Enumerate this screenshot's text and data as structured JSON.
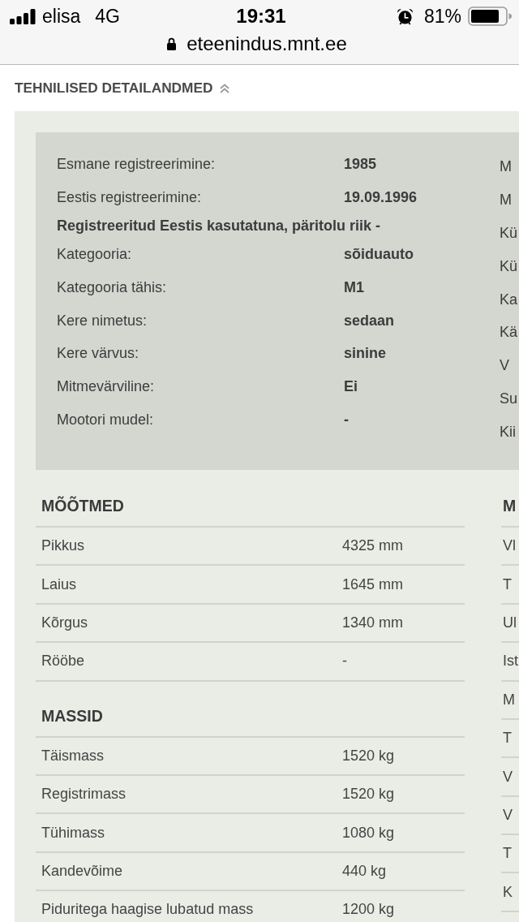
{
  "status_bar": {
    "carrier": "elisa",
    "network": "4G",
    "time": "19:31",
    "battery_percent": "81%"
  },
  "address_bar": {
    "url": "eteenindus.mnt.ee"
  },
  "section": {
    "title": "TEHNILISED DETAILANDMED",
    "expanded": true
  },
  "summary": {
    "left": [
      {
        "kind": "pair",
        "label": "Esmane registreerimine:",
        "value": "1985"
      },
      {
        "kind": "pair",
        "label": "Eestis registreerimine:",
        "value": "19.09.1996"
      },
      {
        "kind": "note",
        "text": "Registreeritud Eestis kasutatuna, päritolu riik -"
      },
      {
        "kind": "pair",
        "label": "Kategooria:",
        "value": "sõiduauto"
      },
      {
        "kind": "pair",
        "label": "Kategooria tähis:",
        "value": "M1"
      },
      {
        "kind": "pair",
        "label": "Kere nimetus:",
        "value": "sedaan"
      },
      {
        "kind": "pair",
        "label": "Kere värvus:",
        "value": "sinine"
      },
      {
        "kind": "pair",
        "label": "Mitmevärviline:",
        "value": "Ei"
      },
      {
        "kind": "pair",
        "label": "Mootori mudel:",
        "value": "-"
      }
    ],
    "right": [
      "M",
      "M",
      "Kü",
      "Kü",
      "Ka",
      "Kä",
      "V",
      "Su",
      "Kii"
    ]
  },
  "tables": {
    "left": [
      {
        "title": "MÕÕTMED",
        "rows": [
          {
            "label": "Pikkus",
            "value": "4325 mm"
          },
          {
            "label": "Laius",
            "value": "1645 mm"
          },
          {
            "label": "Kõrgus",
            "value": "1340 mm"
          },
          {
            "label": "Rööbe",
            "value": "-"
          }
        ]
      },
      {
        "title": "MASSID",
        "rows": [
          {
            "label": "Täismass",
            "value": "1520 kg"
          },
          {
            "label": "Registrimass",
            "value": "1520 kg"
          },
          {
            "label": "Tühimass",
            "value": "1080 kg"
          },
          {
            "label": "Kandevõime",
            "value": "440 kg"
          },
          {
            "label": "Piduritega haagise lubatud mass",
            "value": "1200 kg"
          }
        ]
      }
    ],
    "right": {
      "title": "M",
      "rows": [
        "Vl",
        "T",
        "Ul",
        "Ist",
        "M",
        "T",
        "V",
        "V",
        "T",
        "K"
      ]
    }
  }
}
